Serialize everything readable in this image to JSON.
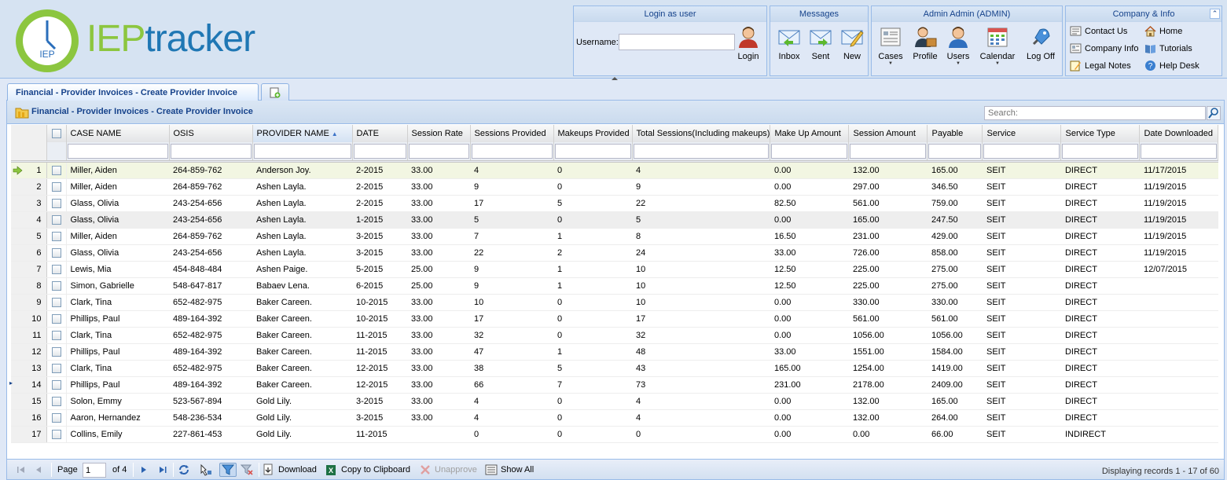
{
  "app": {
    "logo_text": "IEPtracker",
    "logo_badge": "IEP",
    "brand_green": "#8cc63f",
    "brand_blue": "#1f77b4"
  },
  "login": {
    "title": "Login as user",
    "username_label": "Username:",
    "username_value": "",
    "login_label": "Login"
  },
  "messages": {
    "title": "Messages",
    "inbox": "Inbox",
    "sent": "Sent",
    "new": "New"
  },
  "admin": {
    "title": "Admin Admin (ADMIN)",
    "cases": "Cases",
    "profile": "Profile",
    "users": "Users",
    "calendar": "Calendar",
    "logoff": "Log Off"
  },
  "company": {
    "title": "Company & Info",
    "contact_us": "Contact Us",
    "home": "Home",
    "company_info": "Company Info",
    "tutorials": "Tutorials",
    "legal_notes": "Legal Notes",
    "help_desk": "Help Desk"
  },
  "tabs": {
    "active": "Financial - Provider Invoices - Create Provider Invoice"
  },
  "grid": {
    "title": "Financial - Provider Invoices - Create Provider Invoice",
    "search_placeholder": "Search:",
    "columns": [
      "CASE NAME",
      "OSIS",
      "PROVIDER NAME",
      "DATE",
      "Session Rate",
      "Sessions Provided",
      "Makeups Provided",
      "Total Sessions(Including makeups)",
      "Make Up Amount",
      "Session Amount",
      "Payable",
      "Service",
      "Service Type",
      "Date Downloaded"
    ],
    "sorted_column": "PROVIDER NAME",
    "sort_direction": "ascending",
    "selected_row": 1,
    "rows": [
      [
        "1",
        "Miller, Aiden",
        "264-859-762",
        "Anderson Joy.",
        "2-2015",
        "33.00",
        "4",
        "0",
        "4",
        "0.00",
        "132.00",
        "165.00",
        "SEIT",
        "DIRECT",
        "11/17/2015"
      ],
      [
        "2",
        "Miller, Aiden",
        "264-859-762",
        "Ashen Layla.",
        "2-2015",
        "33.00",
        "9",
        "0",
        "9",
        "0.00",
        "297.00",
        "346.50",
        "SEIT",
        "DIRECT",
        "11/19/2015"
      ],
      [
        "3",
        "Glass, Olivia",
        "243-254-656",
        "Ashen Layla.",
        "2-2015",
        "33.00",
        "17",
        "5",
        "22",
        "82.50",
        "561.00",
        "759.00",
        "SEIT",
        "DIRECT",
        "11/19/2015"
      ],
      [
        "4",
        "Glass, Olivia",
        "243-254-656",
        "Ashen Layla.",
        "1-2015",
        "33.00",
        "5",
        "0",
        "5",
        "0.00",
        "165.00",
        "247.50",
        "SEIT",
        "DIRECT",
        "11/19/2015"
      ],
      [
        "5",
        "Miller, Aiden",
        "264-859-762",
        "Ashen Layla.",
        "3-2015",
        "33.00",
        "7",
        "1",
        "8",
        "16.50",
        "231.00",
        "429.00",
        "SEIT",
        "DIRECT",
        "11/19/2015"
      ],
      [
        "6",
        "Glass, Olivia",
        "243-254-656",
        "Ashen Layla.",
        "3-2015",
        "33.00",
        "22",
        "2",
        "24",
        "33.00",
        "726.00",
        "858.00",
        "SEIT",
        "DIRECT",
        "11/19/2015"
      ],
      [
        "7",
        "Lewis, Mia",
        "454-848-484",
        "Ashen Paige.",
        "5-2015",
        "25.00",
        "9",
        "1",
        "10",
        "12.50",
        "225.00",
        "275.00",
        "SEIT",
        "DIRECT",
        "12/07/2015"
      ],
      [
        "8",
        "Simon, Gabrielle",
        "548-647-817",
        "Babaev Lena.",
        "6-2015",
        "25.00",
        "9",
        "1",
        "10",
        "12.50",
        "225.00",
        "275.00",
        "SEIT",
        "DIRECT",
        ""
      ],
      [
        "9",
        "Clark, Tina",
        "652-482-975",
        "Baker Careen.",
        "10-2015",
        "33.00",
        "10",
        "0",
        "10",
        "0.00",
        "330.00",
        "330.00",
        "SEIT",
        "DIRECT",
        ""
      ],
      [
        "10",
        "Phillips, Paul",
        "489-164-392",
        "Baker Careen.",
        "10-2015",
        "33.00",
        "17",
        "0",
        "17",
        "0.00",
        "561.00",
        "561.00",
        "SEIT",
        "DIRECT",
        ""
      ],
      [
        "11",
        "Clark, Tina",
        "652-482-975",
        "Baker Careen.",
        "11-2015",
        "33.00",
        "32",
        "0",
        "32",
        "0.00",
        "1056.00",
        "1056.00",
        "SEIT",
        "DIRECT",
        ""
      ],
      [
        "12",
        "Phillips, Paul",
        "489-164-392",
        "Baker Careen.",
        "11-2015",
        "33.00",
        "47",
        "1",
        "48",
        "33.00",
        "1551.00",
        "1584.00",
        "SEIT",
        "DIRECT",
        ""
      ],
      [
        "13",
        "Clark, Tina",
        "652-482-975",
        "Baker Careen.",
        "12-2015",
        "33.00",
        "38",
        "5",
        "43",
        "165.00",
        "1254.00",
        "1419.00",
        "SEIT",
        "DIRECT",
        ""
      ],
      [
        "14",
        "Phillips, Paul",
        "489-164-392",
        "Baker Careen.",
        "12-2015",
        "33.00",
        "66",
        "7",
        "73",
        "231.00",
        "2178.00",
        "2409.00",
        "SEIT",
        "DIRECT",
        ""
      ],
      [
        "15",
        "Solon, Emmy",
        "523-567-894",
        "Gold Lily.",
        "3-2015",
        "33.00",
        "4",
        "0",
        "4",
        "0.00",
        "132.00",
        "165.00",
        "SEIT",
        "DIRECT",
        ""
      ],
      [
        "16",
        "Aaron, Hernandez",
        "548-236-534",
        "Gold Lily.",
        "3-2015",
        "33.00",
        "4",
        "0",
        "4",
        "0.00",
        "132.00",
        "264.00",
        "SEIT",
        "DIRECT",
        ""
      ],
      [
        "17",
        "Collins, Emily",
        "227-861-453",
        "Gold Lily.",
        "11-2015",
        "",
        "0",
        "0",
        "0",
        "0.00",
        "0.00",
        "66.00",
        "SEIT",
        "INDIRECT",
        ""
      ]
    ]
  },
  "paging": {
    "page_label": "Page",
    "page_value": "1",
    "of_label": "of 4",
    "download": "Download",
    "copy": "Copy to Clipboard",
    "unapprove": "Unapprove",
    "show_all": "Show All",
    "display_info": "Displaying records 1 - 17 of 60"
  }
}
